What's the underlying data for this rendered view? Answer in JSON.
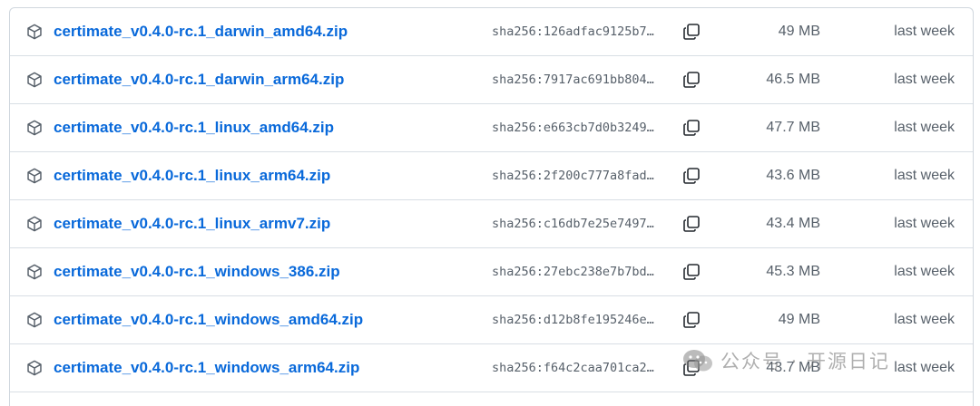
{
  "assets": [
    {
      "name": "certimate_v0.4.0-rc.1_darwin_amd64.zip",
      "sha": "sha256:126adfac9125b7…",
      "size": "49 MB",
      "date": "last week"
    },
    {
      "name": "certimate_v0.4.0-rc.1_darwin_arm64.zip",
      "sha": "sha256:7917ac691bb804…",
      "size": "46.5 MB",
      "date": "last week"
    },
    {
      "name": "certimate_v0.4.0-rc.1_linux_amd64.zip",
      "sha": "sha256:e663cb7d0b3249…",
      "size": "47.7 MB",
      "date": "last week"
    },
    {
      "name": "certimate_v0.4.0-rc.1_linux_arm64.zip",
      "sha": "sha256:2f200c777a8fad…",
      "size": "43.6 MB",
      "date": "last week"
    },
    {
      "name": "certimate_v0.4.0-rc.1_linux_armv7.zip",
      "sha": "sha256:c16db7e25e7497…",
      "size": "43.4 MB",
      "date": "last week"
    },
    {
      "name": "certimate_v0.4.0-rc.1_windows_386.zip",
      "sha": "sha256:27ebc238e7b7bd…",
      "size": "45.3 MB",
      "date": "last week"
    },
    {
      "name": "certimate_v0.4.0-rc.1_windows_amd64.zip",
      "sha": "sha256:d12b8fe195246e…",
      "size": "49 MB",
      "date": "last week"
    },
    {
      "name": "certimate_v0.4.0-rc.1_windows_arm64.zip",
      "sha": "sha256:f64c2caa701ca2…",
      "size": "43.7 MB",
      "date": "last week"
    }
  ],
  "icons": {
    "asset": "package-icon",
    "copy": "copy-icon"
  },
  "colors": {
    "link": "#0969da",
    "muted": "#57606a",
    "border": "#d0d7de"
  },
  "watermark": {
    "text": "公众号 · 开源日记"
  }
}
